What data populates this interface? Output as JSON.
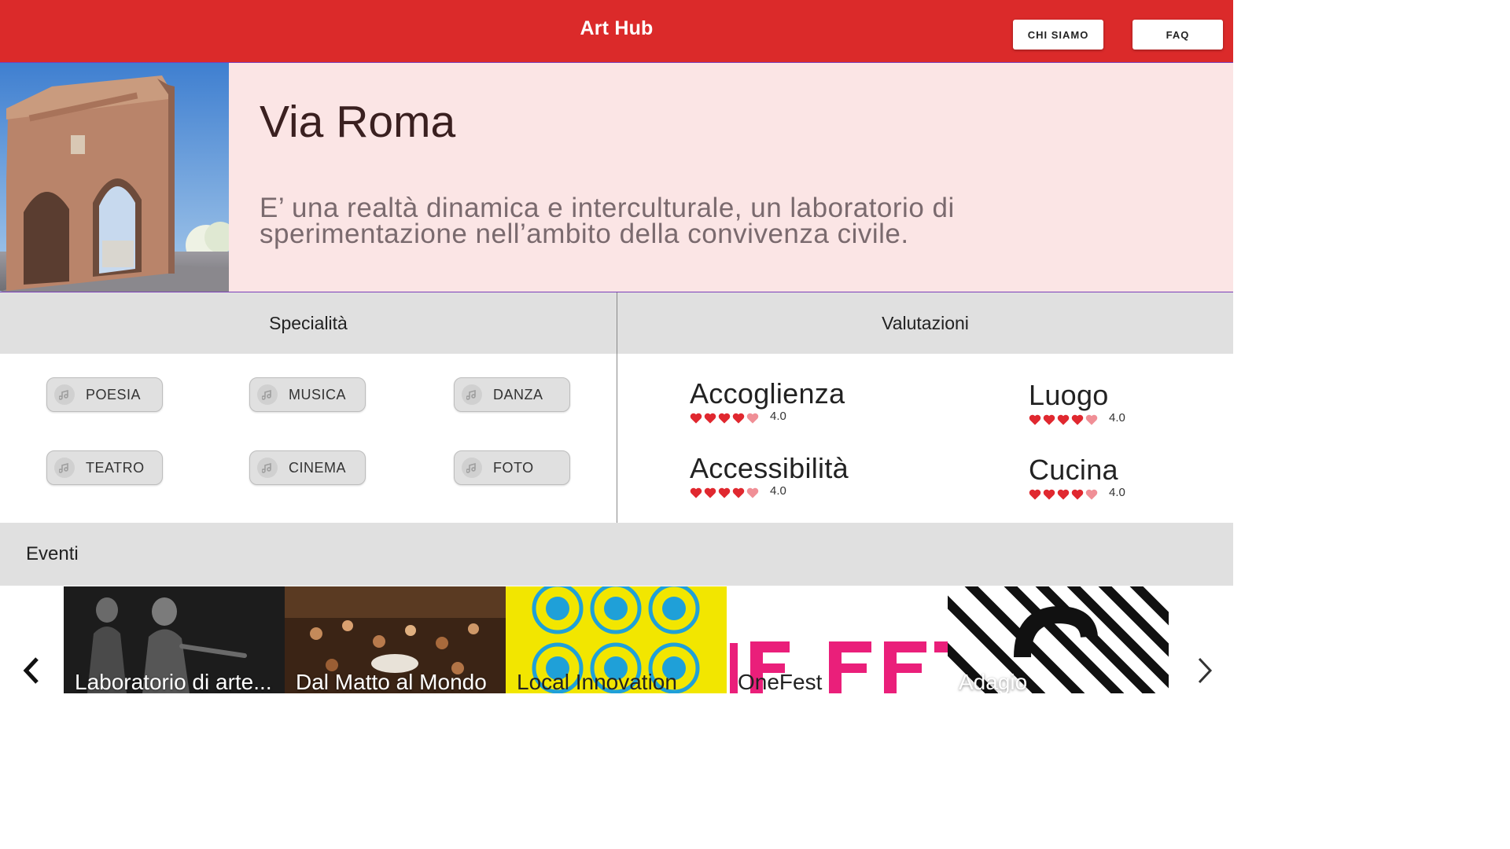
{
  "header": {
    "title": "Art Hub",
    "nav": [
      {
        "label": "CHI SIAMO"
      },
      {
        "label": "FAQ"
      }
    ],
    "color": "#db2a2a"
  },
  "hero": {
    "name": "Via Roma",
    "description": "E’ una realtà dinamica e interculturale, un laboratorio di sperimentazione nell’ambito della convivenza civile.",
    "background": "#fbe5e5"
  },
  "specialita": {
    "title": "Specialità",
    "chips": [
      {
        "label": "POESIA",
        "icon": "music-note-icon"
      },
      {
        "label": "MUSICA",
        "icon": "music-note-icon"
      },
      {
        "label": "DANZA",
        "icon": "music-note-icon"
      },
      {
        "label": "TEATRO",
        "icon": "music-note-icon"
      },
      {
        "label": "CINEMA",
        "icon": "music-note-icon"
      },
      {
        "label": "FOTO",
        "icon": "music-note-icon"
      }
    ]
  },
  "valutazioni": {
    "title": "Valutazioni",
    "items": [
      {
        "name": "Accoglienza",
        "score": 4.0,
        "score_text": "4.0"
      },
      {
        "name": "Luogo",
        "score": 4.0,
        "score_text": "4.0"
      },
      {
        "name": "Accessibilità",
        "score": 4.0,
        "score_text": "4.0"
      },
      {
        "name": "Cucina",
        "score": 4.0,
        "score_text": "4.0"
      }
    ],
    "max_hearts": 5,
    "heart_color": "#e0282f",
    "heart_empty_color": "#f08f96"
  },
  "eventi": {
    "title": "Eventi",
    "cards": [
      {
        "label": "Laboratorio di arte..."
      },
      {
        "label": "Dal Matto al Mondo"
      },
      {
        "label": "Local Innovation"
      },
      {
        "label": "OneFest"
      },
      {
        "label": "Adagio"
      }
    ]
  }
}
